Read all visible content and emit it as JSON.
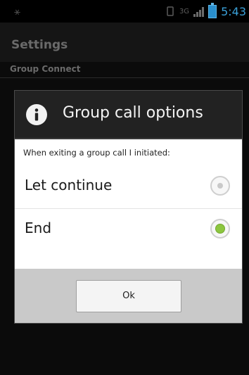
{
  "status_bar": {
    "left_icon": "notification-icon",
    "net_type": "3G",
    "time": "5:43"
  },
  "settings": {
    "title": "Settings",
    "section": "Group Connect"
  },
  "dialog": {
    "title": "Group call options",
    "message": "When exiting a group call I initiated:",
    "options": [
      {
        "label": "Let continue",
        "selected": false
      },
      {
        "label": "End",
        "selected": true
      }
    ],
    "ok_label": "Ok"
  },
  "colors": {
    "accent_green": "#8cc63f",
    "clock_blue": "#3aa0d8"
  }
}
